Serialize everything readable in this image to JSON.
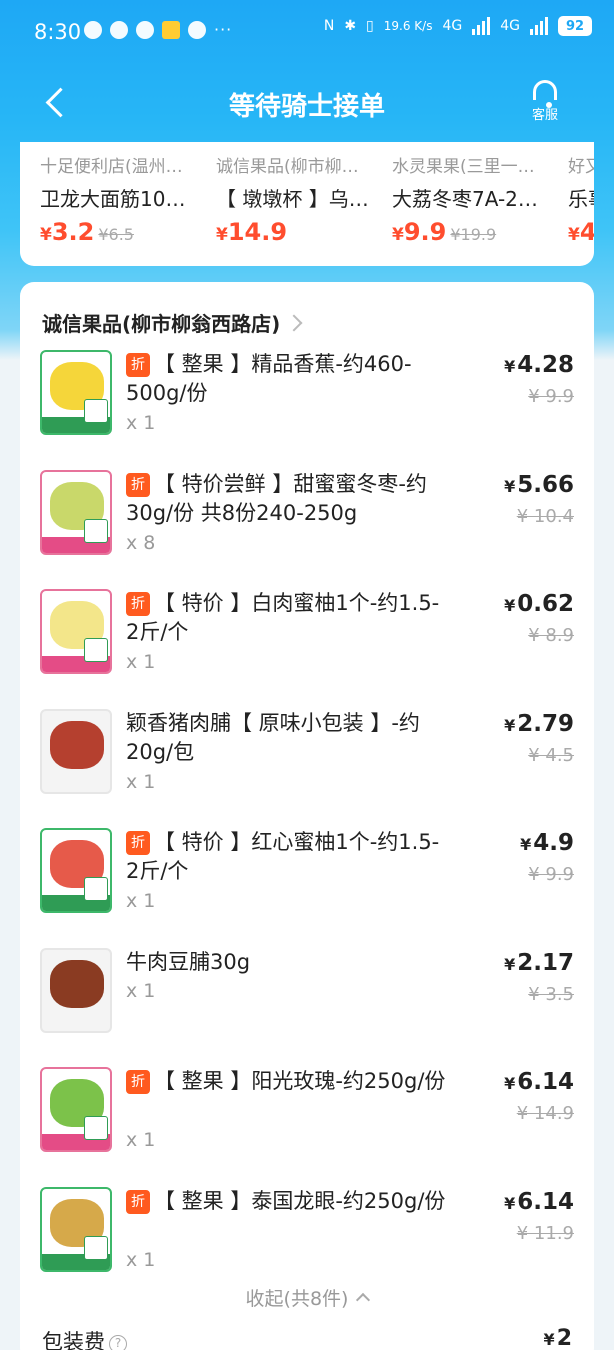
{
  "status_bar": {
    "time": "8:30",
    "speed": "19.6 K/s",
    "battery": "92",
    "net1": "4G",
    "net2": "4G"
  },
  "header": {
    "title": "等待骑士接单",
    "service_label": "客服"
  },
  "recommendations": [
    {
      "store": "十足便利店(温州…",
      "name": "卫龙大面筋10…",
      "currency": "¥",
      "price": "3.2",
      "original": "¥6.5"
    },
    {
      "store": "诚信果品(柳市柳…",
      "name": "【 墩墩杯 】乌…",
      "currency": "¥",
      "price": "14.9",
      "original": ""
    },
    {
      "store": "水灵果果(三里一…",
      "name": "大荔冬枣7A-2…",
      "currency": "¥",
      "price": "9.9",
      "original": "¥19.9"
    },
    {
      "store": "好又",
      "name": "乐事",
      "currency": "¥",
      "price": "4.",
      "original": ""
    }
  ],
  "order": {
    "store_name": "诚信果品(柳市柳翁西路店)",
    "items": [
      {
        "discount_tag": "折",
        "title": "【 整果 】精品香蕉-约460-500g/份",
        "qty": "x 1",
        "price": "4.28",
        "original": "¥ 9.9",
        "thumb_color": "#f5d63a",
        "thumb_style": "green"
      },
      {
        "discount_tag": "折",
        "title": "【 特价尝鲜 】甜蜜蜜冬枣-约30g/份 共8份240-250g",
        "qty": "x 8",
        "price": "5.66",
        "original": "¥ 10.4",
        "thumb_color": "#c9d86a",
        "thumb_style": "pink"
      },
      {
        "discount_tag": "折",
        "title": "【 特价 】白肉蜜柚1个-约1.5-2斤/个",
        "qty": "x 1",
        "price": "0.62",
        "original": "¥ 8.9",
        "thumb_color": "#f3e68a",
        "thumb_style": "pink"
      },
      {
        "discount_tag": "",
        "title": "颖香猪肉脯【 原味小包装 】-约20g/包",
        "qty": "x 1",
        "price": "2.79",
        "original": "¥ 4.5",
        "thumb_color": "#b5402f",
        "thumb_style": "plain"
      },
      {
        "discount_tag": "折",
        "title": "【 特价 】红心蜜柚1个-约1.5-2斤/个",
        "qty": "x 1",
        "price": "4.9",
        "original": "¥ 9.9",
        "thumb_color": "#e65a4a",
        "thumb_style": "green"
      },
      {
        "discount_tag": "",
        "title": "牛肉豆脯30g",
        "qty": "x 1",
        "price": "2.17",
        "original": "¥ 3.5",
        "thumb_color": "#8a3b22",
        "thumb_style": "plain"
      },
      {
        "discount_tag": "折",
        "title": "【 整果 】阳光玫瑰-约250g/份",
        "qty": "x 1",
        "price": "6.14",
        "original": "¥ 14.9",
        "thumb_color": "#7cc24a",
        "thumb_style": "pink"
      },
      {
        "discount_tag": "折",
        "title": "【 整果 】泰国龙眼-约250g/份",
        "qty": "x 1",
        "price": "6.14",
        "original": "¥ 11.9",
        "thumb_color": "#d6a94a",
        "thumb_style": "green"
      }
    ],
    "currency": "¥",
    "collapse_label": "收起(共8件)",
    "packaging_fee_label": "包装费",
    "packaging_fee_value": "2"
  }
}
